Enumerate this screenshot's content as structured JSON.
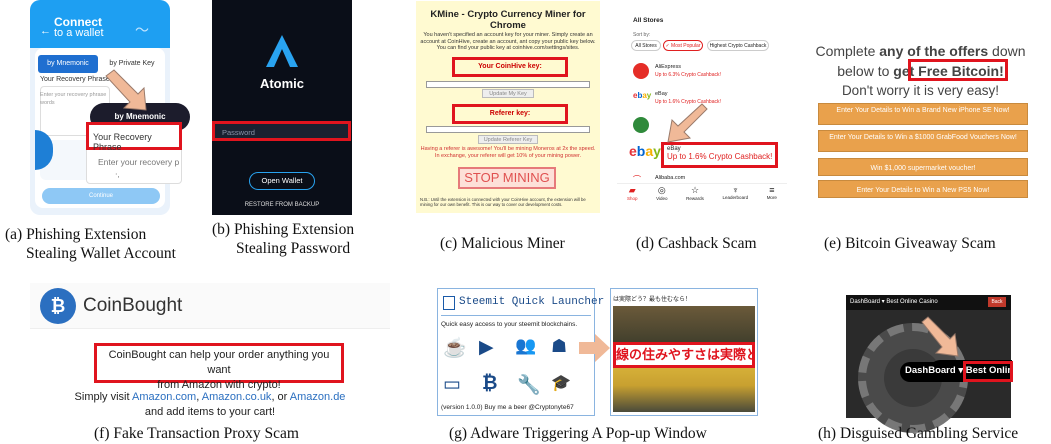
{
  "figure": {
    "captions": {
      "a_line1": "(a) Phishing Extension",
      "a_line2": "Stealing Wallet Account",
      "b_line1": "(b) Phishing Extension",
      "b_line2": "Stealing Password",
      "c": "(c) Malicious Miner",
      "d": "(d) Cashback Scam",
      "e": "(e) Bitcoin Giveaway Scam",
      "f": "(f) Fake Transaction Proxy Scam",
      "g": "(g) Adware Triggering A Pop-up Window",
      "h": "(h) Disguised Gambling Service"
    }
  },
  "panel_a": {
    "title1": "Connect",
    "title2": "to a wallet",
    "tab_mnemonic": "by Mnemonic",
    "tab_private": "by Private Key",
    "label_recovery": "Your Recovery Phrase",
    "placeholder": "Enter your recovery phrase",
    "placeholder2": "words",
    "popup_label": "by Mnemonic",
    "field_label": "Your Recovery Phrase",
    "field_placeholder": "Enter your recovery p",
    "continue": "Continue"
  },
  "panel_b": {
    "brand": "Atomic",
    "password_placeholder": "Password",
    "open_wallet": "Open Wallet",
    "restore": "RESTORE FROM BACKUP"
  },
  "panel_c": {
    "title": "KMine - Crypto Currency Miner for Chrome",
    "intro": "You haven't specified an account key for your miner. Simply create an account at CoinHive, create an account, ant copy your public key below. You can find your public key at coinhive.com/settings/sites.",
    "key_label": "Your CoinHive key:",
    "update_key": "Update My Key",
    "referer_label": "Referer key:",
    "update_referer": "Update Referer Key",
    "referer_note": "Having a referer is awesome! You'll be mining Moneros at 2x the speed. In exchange, your referer will get 10% of your mining power.",
    "stop": "STOP MINING",
    "footnote": "N.B.: Until the extension is connected with your CoinHive account, the extension will be mining for our own benefit. This is our way to cover our development costs."
  },
  "panel_d": {
    "header": "All Stores",
    "sort_label": "Sort by:",
    "chip1": "All Stores",
    "chip2": "✓ Most Popular",
    "chip3": "Highest Crypto Cashback",
    "store1_name": "AliExpress",
    "store1_cb": "Up to 6.3% Crypto Cashback!",
    "store2_name": "eBay",
    "store2_cb": "Up to 1.6% Crypto Cashback!",
    "store_ebay_logo": "ebay",
    "callout_name": "eBay",
    "callout_cb": "Up to 1.6% Crypto Cashback!",
    "store4_name": "Alibaba.com",
    "nav": [
      "Shop",
      "Video",
      "Rewards",
      "Leaderboard",
      "More"
    ]
  },
  "panel_e": {
    "line1a": "Complete ",
    "line1b": "any of the offers",
    "line1c": " down",
    "line2a": "below to ",
    "line2b": "get Free Bitcoin!",
    "line3": "Don't worry it is very easy!",
    "btn1": "Enter Your Details to Win a Brand New iPhone SE Now!",
    "btn2": "Enter Your Details to Win a $1000 GrabFood Vouchers Now!",
    "btn3": "Win $1,000 supermarket voucher!",
    "btn4": "Enter Your Details to Win a New PS5 Now!"
  },
  "panel_f": {
    "brand": "CoinBought",
    "msg1": "CoinBought can help your order anything you want",
    "msg2": "from Amazon with crypto!",
    "visit": "Simply visit ",
    "amazon_com": "Amazon.com",
    "sep1": ", ",
    "amazon_uk": "Amazon.co.uk",
    "sep2": ", or ",
    "amazon_de": "Amazon.de",
    "tail": "and add items to your cart!"
  },
  "panel_g": {
    "title": "Steemit Quick Launcher",
    "subtitle": "Quick easy access to your steemit blockchains.",
    "version": "(version 1.0.0) Buy me a beer @Cryptonyte67",
    "popup_top": "は実際どう？最も住むなら！",
    "popup_banner": "線の住みやすさは実際どう"
  },
  "panel_h": {
    "nav_left": "DashBoard ▾ Best Online Casino",
    "nav_btn": "Back",
    "label": "DashBoard ▾ Best Online Casino"
  },
  "colors": {
    "highlight_red": "#e0141e",
    "arrow": "#f0b998",
    "wallet_blue": "#1e9ff2",
    "coinbought_link": "#2b6fc0",
    "offer_orange": "#e9a14c"
  }
}
